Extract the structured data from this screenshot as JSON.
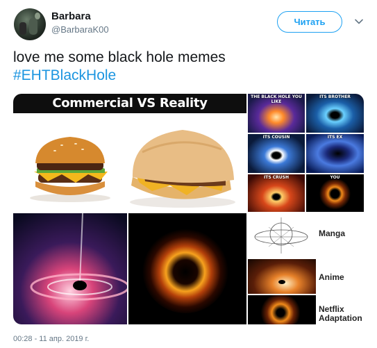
{
  "user": {
    "display_name": "Barbara",
    "handle": "@BarbaraK00",
    "avatar_icon": "user-avatar"
  },
  "follow_button": {
    "label": "Читать",
    "color": "#1da1f2"
  },
  "menu_icon": "chevron-down-icon",
  "tweet": {
    "text": "love me some black hole memes",
    "hashtag": "#EHTBlackHole",
    "hashtag_color": "#1b95e0"
  },
  "media": {
    "commercial_panel": {
      "title": "Commercial VS Reality"
    },
    "grid": [
      {
        "label": "THE BLACK HOLE YOU LIKE"
      },
      {
        "label": "ITS BROTHER"
      },
      {
        "label": "ITS COUSIN"
      },
      {
        "label": "ITS EX"
      },
      {
        "label": "ITS CRUSH"
      },
      {
        "label": "YOU"
      }
    ],
    "side_panels": {
      "manga": "Manga",
      "anime": "Anime",
      "netflix": "Netflix Adaptation"
    }
  },
  "timestamp": "00:28 - 11 апр. 2019 г."
}
